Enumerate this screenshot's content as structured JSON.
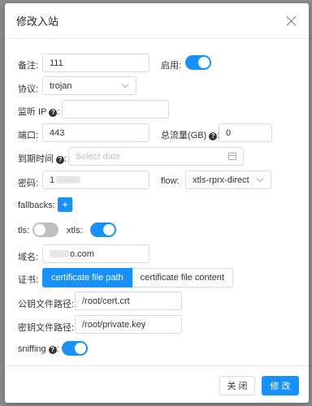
{
  "modal": {
    "title": "修改入站"
  },
  "fields": {
    "remark_label": "备注:",
    "remark_value": "111",
    "enable_label": "启用:",
    "protocol_label": "协议:",
    "protocol_value": "trojan",
    "listen_ip_label": "监听 IP",
    "port_label": "端口:",
    "port_value": "443",
    "total_flow_label": "总流量(GB)",
    "total_flow_value": "0",
    "expire_label": "到期时间",
    "expire_placeholder": "Select date",
    "password_label": "密码:",
    "password_visible": "1",
    "flow_label": "flow:",
    "flow_value": "xtls-rprx-direct",
    "fallbacks_label": "fallbacks:",
    "tls_label": "tls:",
    "xtls_label": "xtls:",
    "domain_label": "域名:",
    "domain_visible": "o.com",
    "cert_label": "证书:",
    "cert_tab_path": "certificate file path",
    "cert_tab_content": "certificate file content",
    "pubkey_label": "公钥文件路径:",
    "pubkey_value": "/root/cert.crt",
    "privkey_label": "密钥文件路径:",
    "privkey_value": "/root/private.key",
    "sniffing_label": "sniffing"
  },
  "toggles": {
    "enable": true,
    "tls": false,
    "xtls": true,
    "sniffing": true
  },
  "buttons": {
    "plus": "+",
    "close": "关 闭",
    "save": "修 改"
  },
  "colors": {
    "primary": "#1890ff",
    "off": "#bfbfbf"
  }
}
